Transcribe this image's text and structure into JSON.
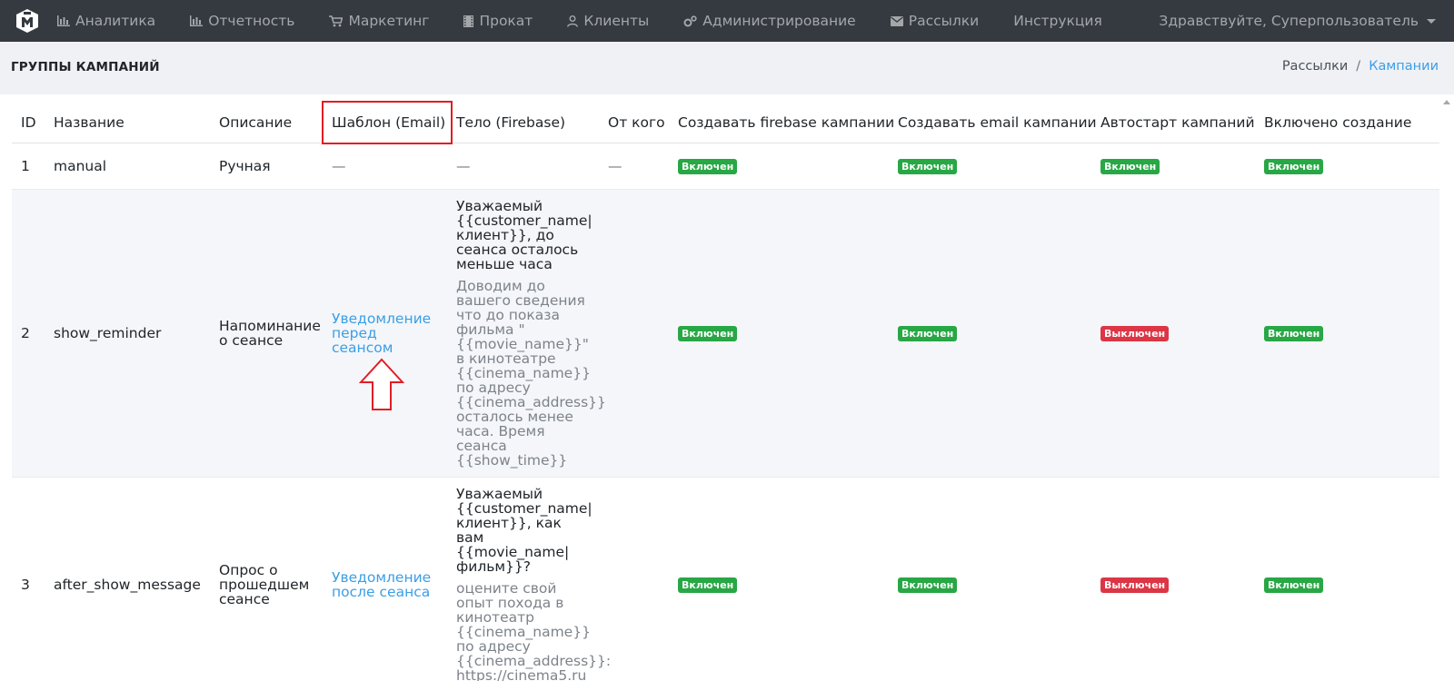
{
  "navbar": {
    "items": [
      {
        "label": "Аналитика",
        "icon": "bar-chart-icon"
      },
      {
        "label": "Отчетность",
        "icon": "bar-chart-icon"
      },
      {
        "label": "Маркетинг",
        "icon": "shopping-cart-icon"
      },
      {
        "label": "Прокат",
        "icon": "film-icon"
      },
      {
        "label": "Клиенты",
        "icon": "user-icon"
      },
      {
        "label": "Администрирование",
        "icon": "gears-icon"
      },
      {
        "label": "Рассылки",
        "icon": "envelope-icon"
      },
      {
        "label": "Инструкция",
        "icon": ""
      }
    ],
    "user_greeting": "Здравствуйте, Суперпользователь"
  },
  "header": {
    "title": "ГРУППЫ КАМПАНИЙ",
    "breadcrumb": [
      "Рассылки",
      "Кампании"
    ],
    "breadcrumb_sep": "/"
  },
  "table": {
    "columns": [
      "ID",
      "Название",
      "Описание",
      "Шаблон (Email)",
      "Тело (Firebase)",
      "От кого",
      "Создавать firebase кампании",
      "Создавать email кампании",
      "Автостарт кампаний",
      "Включено создание"
    ],
    "highlighted_column": "Шаблон (Email)",
    "rows": [
      {
        "id": "1",
        "name": "manual",
        "description": "Ручная",
        "template": "—",
        "body_title": "—",
        "body_text": "",
        "from": "—",
        "firebase": "Включен",
        "email": "Включен",
        "autostart": "Включен",
        "enabled": "Включен"
      },
      {
        "id": "2",
        "name": "show_reminder",
        "description": "Напоминание о сеансе",
        "template": "Уведомление перед сеансом",
        "body_title": "Уважаемый {{customer_name| клиент}}, до сеанса осталось меньше часа",
        "body_text": "Доводим до вашего сведения что до показа фильма \"{{movie_name}}\" в кинотеатре {{cinema_name}} по адресу {{cinema_address}} осталось менее часа. Время сеанса {{show_time}}",
        "from": "",
        "firebase": "Включен",
        "email": "Включен",
        "autostart": "Выключен",
        "enabled": "Включен"
      },
      {
        "id": "3",
        "name": "after_show_message",
        "description": "Опрос о прошедшем сеансе",
        "template": "Уведомление после сеанса",
        "body_title": "Уважаемый {{customer_name| клиент}}, как вам {{movie_name| фильм}}?",
        "body_text": "оцените свой опыт похода в кинотеатр {{cinema_name}} по адресу {{cinema_address}}: https://cinema5.ru",
        "from": "",
        "firebase": "Включен",
        "email": "Включен",
        "autostart": "Выключен",
        "enabled": "Включен"
      }
    ]
  },
  "colors": {
    "navbar_bg": "#343a40",
    "header_bg": "#f0f1f5",
    "link": "#3b9ee6",
    "badge_on": "#28a745",
    "badge_off": "#dc3545",
    "annotation": "#e11d24"
  }
}
